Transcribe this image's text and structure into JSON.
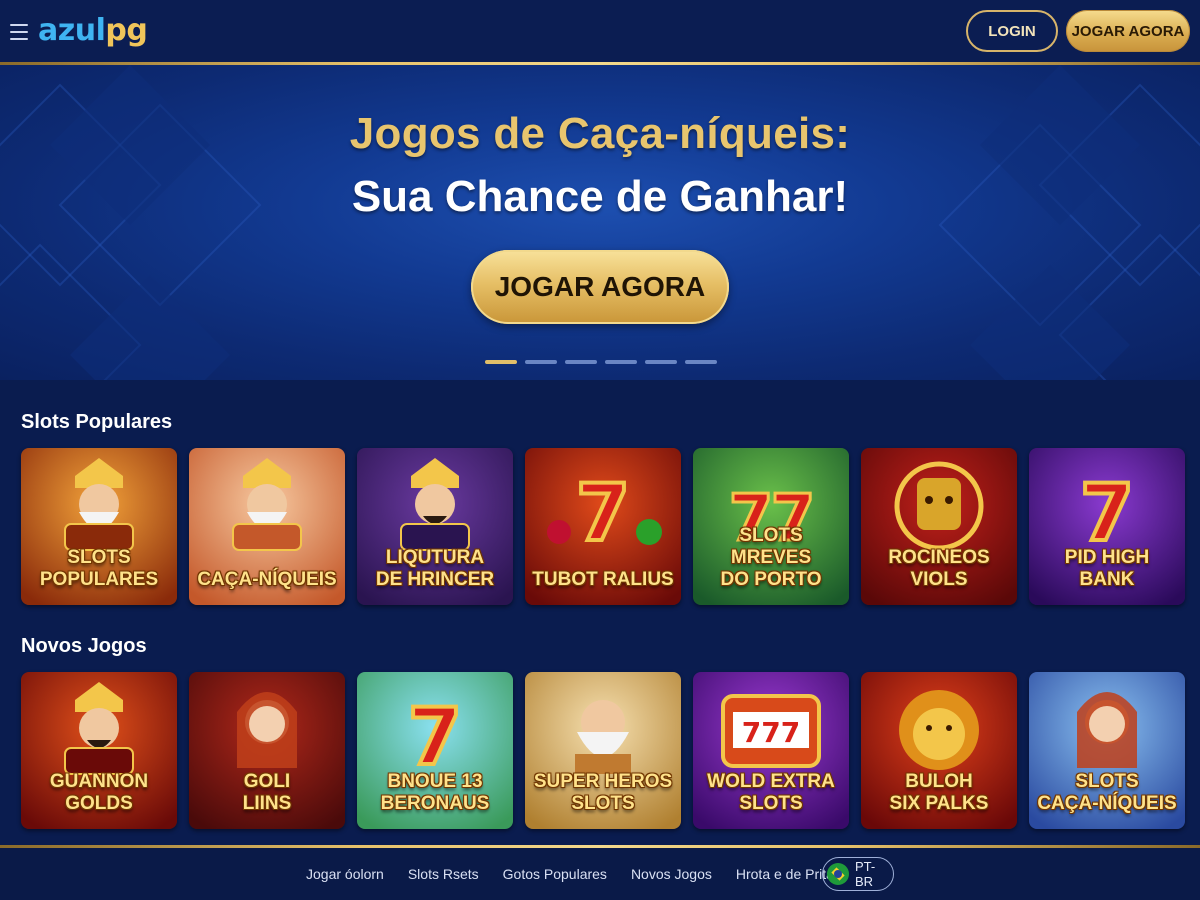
{
  "header": {
    "logo_part1": "azul",
    "logo_part2": "pg",
    "login_label": "LOGIN",
    "play_label": "JOGAR AGORA"
  },
  "hero": {
    "title_line1": "Jogos de Caça-níqueis:",
    "title_line2": "Sua Chance de Ganhar!",
    "cta_label": "JOGAR AGORA",
    "slides_total": 6,
    "active_slide": 1
  },
  "sections": {
    "popular": {
      "title": "Slots Populares",
      "games": [
        {
          "title": "SLOTS\nPOPULARES",
          "icon": "fortune-god-icon",
          "bg": [
            "#f2a23a",
            "#8a2a0a"
          ]
        },
        {
          "title": "CAÇA-NÍQUEIS",
          "icon": "fortune-god-icon",
          "bg": [
            "#f7c9a0",
            "#c4582a"
          ]
        },
        {
          "title": "LIQUTURA\nDE HRINCER",
          "icon": "emperor-icon",
          "bg": [
            "#6a3aa0",
            "#2a1450"
          ]
        },
        {
          "title": "TUBOT RALIUS",
          "icon": "seven-fruit-icon",
          "bg": [
            "#e04a1a",
            "#6a0a08"
          ]
        },
        {
          "title": "SLOTS MREVES\nDO PORTO",
          "icon": "double-seven-icon",
          "bg": [
            "#6ac04a",
            "#1a5a2a"
          ]
        },
        {
          "title": "ROCINEOS\nVIOLS",
          "icon": "golden-mask-icon",
          "bg": [
            "#c0201a",
            "#5a0808"
          ]
        },
        {
          "title": "PID HIGH\nBANK",
          "icon": "seven-icon",
          "bg": [
            "#8a3ad0",
            "#2a0a5a"
          ]
        }
      ]
    },
    "new": {
      "title": "Novos Jogos",
      "games": [
        {
          "title": "GUANNON\nGOLDS",
          "icon": "emperor-icon",
          "bg": [
            "#e0501a",
            "#6a0a08"
          ]
        },
        {
          "title": "GOLI\nLIINS",
          "icon": "goddess-icon",
          "bg": [
            "#b0281a",
            "#4a0a0a"
          ]
        },
        {
          "title": "BNOUE 13\nBERONAUS",
          "icon": "seven-icon",
          "bg": [
            "#8ae0f0",
            "#3a9a5a"
          ]
        },
        {
          "title": "SUPER HEROS\nSLOTS",
          "icon": "zeus-icon",
          "bg": [
            "#f6e0b0",
            "#b08030"
          ]
        },
        {
          "title": "WOLD EXTRA\nSLOTS",
          "icon": "slot-machine-icon",
          "bg": [
            "#9a3ad0",
            "#3a0a6a"
          ]
        },
        {
          "title": "BULOH\nSIX PALKS",
          "icon": "lion-icon",
          "bg": [
            "#e0401a",
            "#6a0808"
          ]
        },
        {
          "title": "SLOTS\nCAÇA-NÍQUEIS",
          "icon": "goddess-icon",
          "bg": [
            "#8ac0f0",
            "#2a4aa0"
          ]
        }
      ]
    }
  },
  "footer": {
    "links": [
      "Jogar óolorn",
      "Slots Rsets",
      "Gotos Populares",
      "Novos Jogos",
      "Hrota e de Pritar"
    ],
    "language": "PT-BR"
  },
  "colors": {
    "gold": "#e1be69",
    "navy": "#0b1d52",
    "logo_blue": "#3fb4f2",
    "logo_gold": "#f0c55a"
  }
}
